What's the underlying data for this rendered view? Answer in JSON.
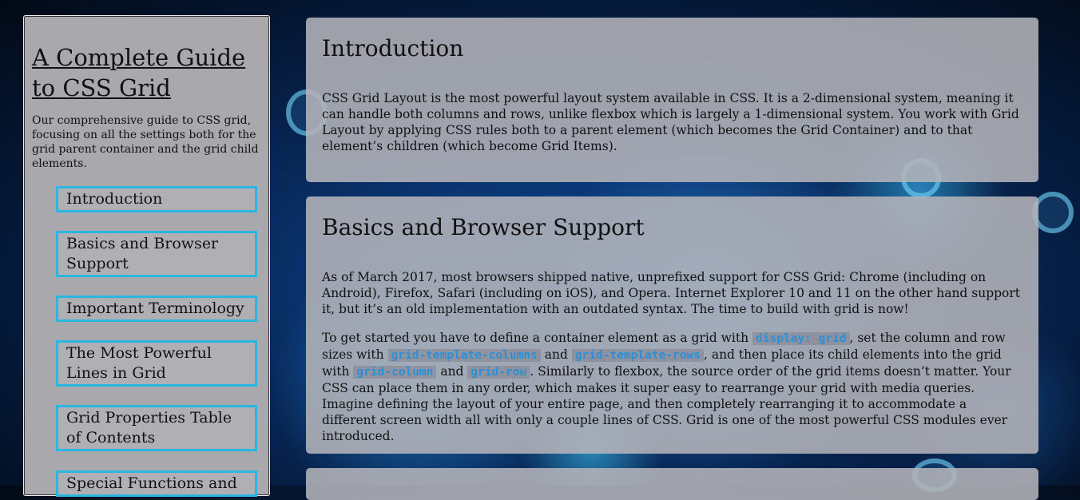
{
  "sidebar": {
    "title": "A Complete Guide to CSS Grid",
    "description": "Our comprehensive guide to CSS grid, focusing on all the settings both for the grid parent container and the grid child elements.",
    "nav": [
      {
        "label": "Introduction"
      },
      {
        "label": "Basics and Browser Support"
      },
      {
        "label": "Important Terminology"
      },
      {
        "label": "The Most Powerful Lines in Grid"
      },
      {
        "label": "Grid Properties Table of Contents"
      },
      {
        "label": "Special Functions and"
      }
    ]
  },
  "sections": [
    {
      "heading": "Introduction",
      "paragraph": "CSS Grid Layout is the most powerful layout system available in CSS. It is a 2-dimensional system, meaning it can handle both columns and rows, unlike flexbox which is largely a 1-dimensional system. You work with Grid Layout by applying CSS rules both to a parent element (which becomes the Grid Container) and to that element’s children (which become Grid Items)."
    },
    {
      "heading": "Basics and Browser Support",
      "paragraph1": "As of March 2017, most browsers shipped native, unprefixed support for CSS Grid: Chrome (including on Android), Firefox, Safari (including on iOS), and Opera. Internet Explorer 10 and 11 on the other hand support it, but it’s an old implementation with an outdated syntax. The time to build with grid is now!",
      "p2": {
        "t1": "To get started you have to define a container element as a grid with ",
        "c1": "display: grid",
        "t2": ", set the column and row sizes with ",
        "c2": "grid-template-columns",
        "t3": " and ",
        "c3": "grid-template-rows",
        "t4": ", and then place its child elements into the grid with ",
        "c4": "grid-column",
        "t5": " and ",
        "c5": "grid-row",
        "t6": ". Similarly to flexbox, the source order of the grid items doesn’t matter. Your CSS can place them in any order, which makes it super easy to rearrange your grid with media queries. Imagine defining the layout of your entire page, and then completely rearranging it to accommodate a different screen width all with only a couple lines of CSS. Grid is one of the most powerful CSS modules ever introduced."
      }
    }
  ]
}
